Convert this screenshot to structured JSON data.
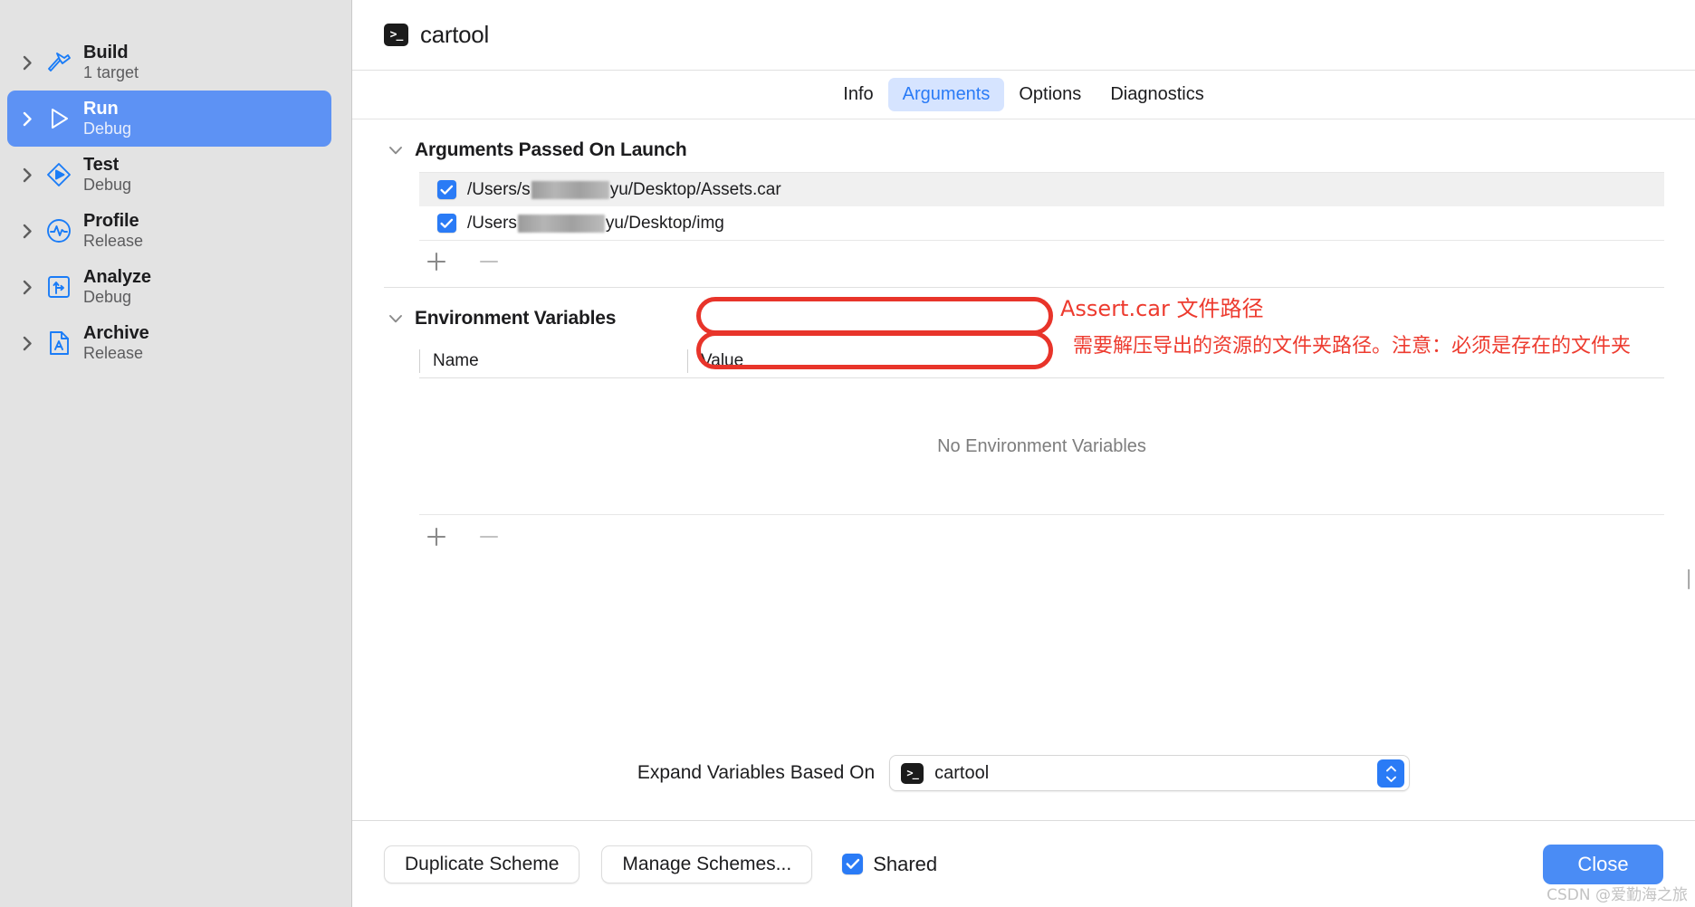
{
  "sidebar": {
    "items": [
      {
        "title": "Build",
        "subtitle": "1 target",
        "icon": "hammer-icon",
        "selected": false
      },
      {
        "title": "Run",
        "subtitle": "Debug",
        "icon": "play-icon",
        "selected": true
      },
      {
        "title": "Test",
        "subtitle": "Debug",
        "icon": "diamond-play-icon",
        "selected": false
      },
      {
        "title": "Profile",
        "subtitle": "Release",
        "icon": "waveform-icon",
        "selected": false
      },
      {
        "title": "Analyze",
        "subtitle": "Debug",
        "icon": "analyze-icon",
        "selected": false
      },
      {
        "title": "Archive",
        "subtitle": "Release",
        "icon": "archive-icon",
        "selected": false
      }
    ]
  },
  "header": {
    "scheme_name": "cartool",
    "icon": "terminal-icon",
    "prompt_glyph": ">_"
  },
  "tabs": [
    {
      "label": "Info",
      "active": false
    },
    {
      "label": "Arguments",
      "active": true
    },
    {
      "label": "Options",
      "active": false
    },
    {
      "label": "Diagnostics",
      "active": false
    }
  ],
  "arguments_section": {
    "title": "Arguments Passed On Launch",
    "rows": [
      {
        "checked": true,
        "prefix": "/Users/s",
        "suffix": "yu/Desktop/Assets.car",
        "redacted": true
      },
      {
        "checked": true,
        "prefix": "/Users",
        "suffix": "yu/Desktop/img",
        "redacted": true
      }
    ],
    "add_label": "+",
    "remove_label": "−"
  },
  "annotations": [
    {
      "text": "Assert.car 文件路径"
    },
    {
      "text": "需要解压导出的资源的文件夹路径。注意：必须是存在的文件夹"
    }
  ],
  "env_section": {
    "title": "Environment Variables",
    "columns": [
      "Name",
      "Value"
    ],
    "empty_text": "No Environment Variables",
    "add_label": "+",
    "remove_label": "−"
  },
  "expand": {
    "label": "Expand Variables Based On",
    "value": "cartool",
    "icon": "terminal-icon",
    "stepper": "stepper-icon"
  },
  "footer": {
    "duplicate_label": "Duplicate Scheme",
    "manage_label": "Manage Schemes...",
    "shared_label": "Shared",
    "shared_checked": true,
    "close_label": "Close"
  },
  "watermark": {
    "text": "CSDN @爱勤海之旅"
  },
  "colors": {
    "accent": "#2a7bf6",
    "selection": "#5d92f4",
    "annotation_red": "#ed3b2f",
    "sidebar_bg": "#e3e3e3",
    "tab_active_bg": "#d6e4ff"
  }
}
